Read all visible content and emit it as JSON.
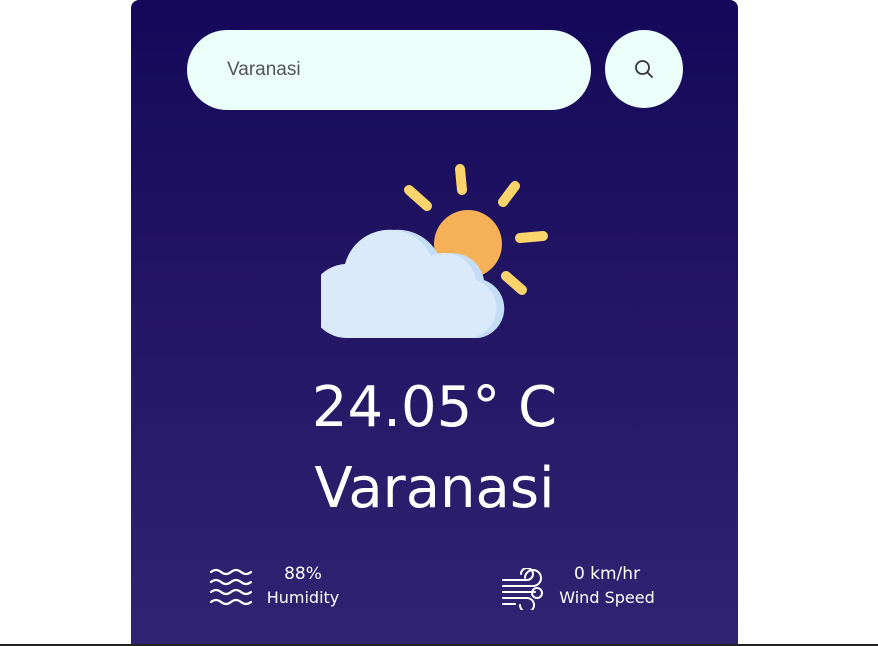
{
  "search": {
    "value": "Varanasi",
    "icon": "search-icon"
  },
  "weather": {
    "icon": "partly-cloudy-icon",
    "temperature": "24.05° C",
    "city": "Varanasi"
  },
  "stats": {
    "humidity": {
      "icon": "waves-icon",
      "value": "88%",
      "label": "Humidity"
    },
    "wind": {
      "icon": "wind-icon",
      "value": "0 km/hr",
      "label": "Wind Speed"
    }
  },
  "colors": {
    "card_top": "#15085a",
    "card_bottom": "#302472",
    "input_bg": "#ebfefa",
    "sun": "#f6b157",
    "sun_rays": "#fbd56b",
    "cloud": "#dbeafb",
    "cloud_shade": "#c4ddf6"
  }
}
